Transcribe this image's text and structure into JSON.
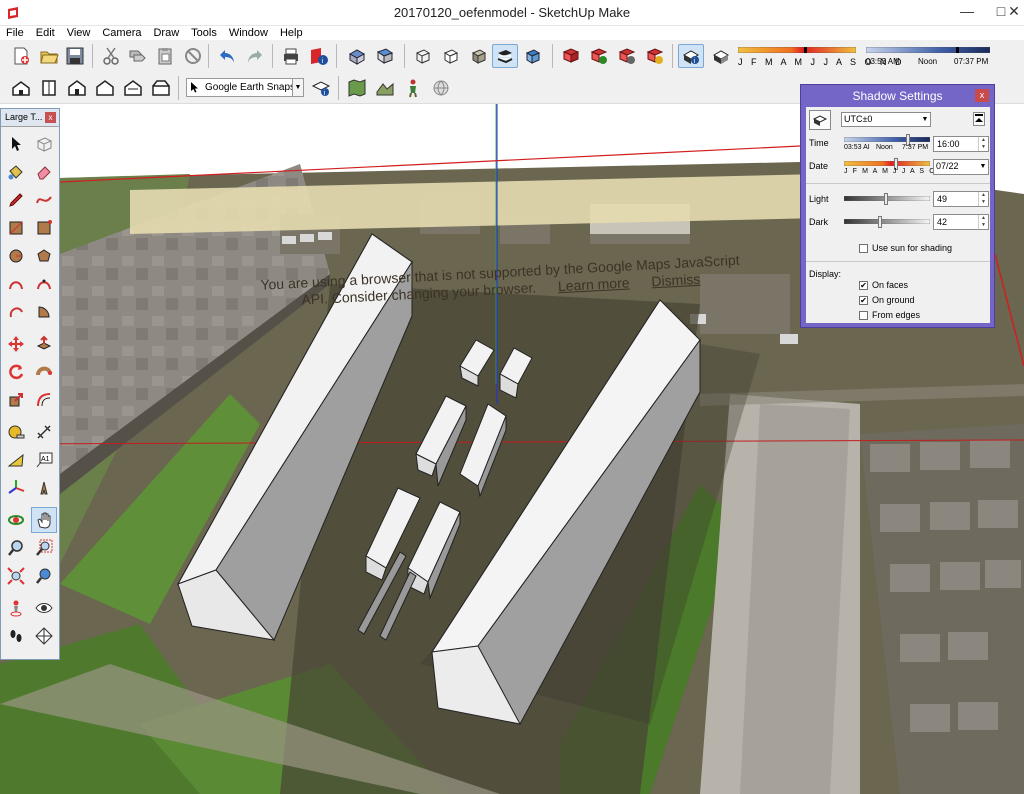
{
  "window": {
    "title": "20170120_oefenmodel - SketchUp Make",
    "minimize": "—",
    "maximize": "□",
    "close": "✕"
  },
  "menu": [
    "File",
    "Edit",
    "View",
    "Camera",
    "Draw",
    "Tools",
    "Window",
    "Help"
  ],
  "toolbar": {
    "geo_location_select": "Google Earth Snapsl",
    "shadow_months": "J F M A M J J A S O N D",
    "shadow_time_start": "03:53 AM",
    "shadow_time_noon": "Noon",
    "shadow_time_end": "07:37 PM"
  },
  "browser_warning": {
    "line1": "You are using a browser that is not supported by the Google Maps JavaScript",
    "line2": "API. Consider changing your browser.",
    "learn_more": "Learn more",
    "dismiss": "Dismiss"
  },
  "tool_panel": {
    "title": "Large T...",
    "close": "x"
  },
  "shadow_settings": {
    "title": "Shadow Settings",
    "close": "x",
    "timezone": "UTC±0",
    "time_label": "Time",
    "time_start": "03:53 AI",
    "time_noon": "Noon",
    "time_end": "7:37 PM",
    "time_value": "16:00",
    "date_label": "Date",
    "date_months": "J F M A M J J A S O N D",
    "date_value": "07/22",
    "light_label": "Light",
    "light_value": "49",
    "light_level": 49,
    "dark_label": "Dark",
    "dark_value": "42",
    "dark_level": 42,
    "use_sun_label": "Use sun for shading",
    "use_sun_checked": false,
    "display_label": "Display:",
    "on_faces_label": "On faces",
    "on_faces_checked": true,
    "on_ground_label": "On ground",
    "on_ground_checked": true,
    "from_edges_label": "From edges",
    "from_edges_checked": false
  }
}
